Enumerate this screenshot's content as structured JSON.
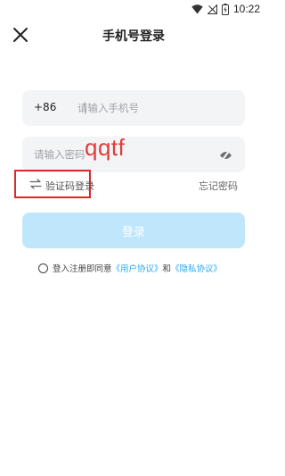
{
  "status_bar": {
    "time": "10:22"
  },
  "header": {
    "title": "手机号登录"
  },
  "phone": {
    "country_code": "+86",
    "separator": "|",
    "placeholder": "请输入手机号"
  },
  "password": {
    "placeholder": "请输入密码"
  },
  "annotation": {
    "text": "qqtf"
  },
  "links": {
    "switch_label": "验证码登录",
    "forgot_label": "忘记密码"
  },
  "login_button": {
    "label": "登录"
  },
  "agreement": {
    "prefix": "登入注册即同意",
    "user_agreement": "《用户协议》",
    "and": "和",
    "privacy_agreement": "《隐私协议》"
  },
  "colors": {
    "accent": "#28a8f0",
    "login_button_bg": "#bfe6fb",
    "field_bg": "#f3f4f6",
    "annotation_red": "#e23a3a"
  },
  "icons": [
    "wifi-icon",
    "signal-icon",
    "battery-icon",
    "close-icon",
    "eye-off-icon",
    "swap-icon"
  ]
}
